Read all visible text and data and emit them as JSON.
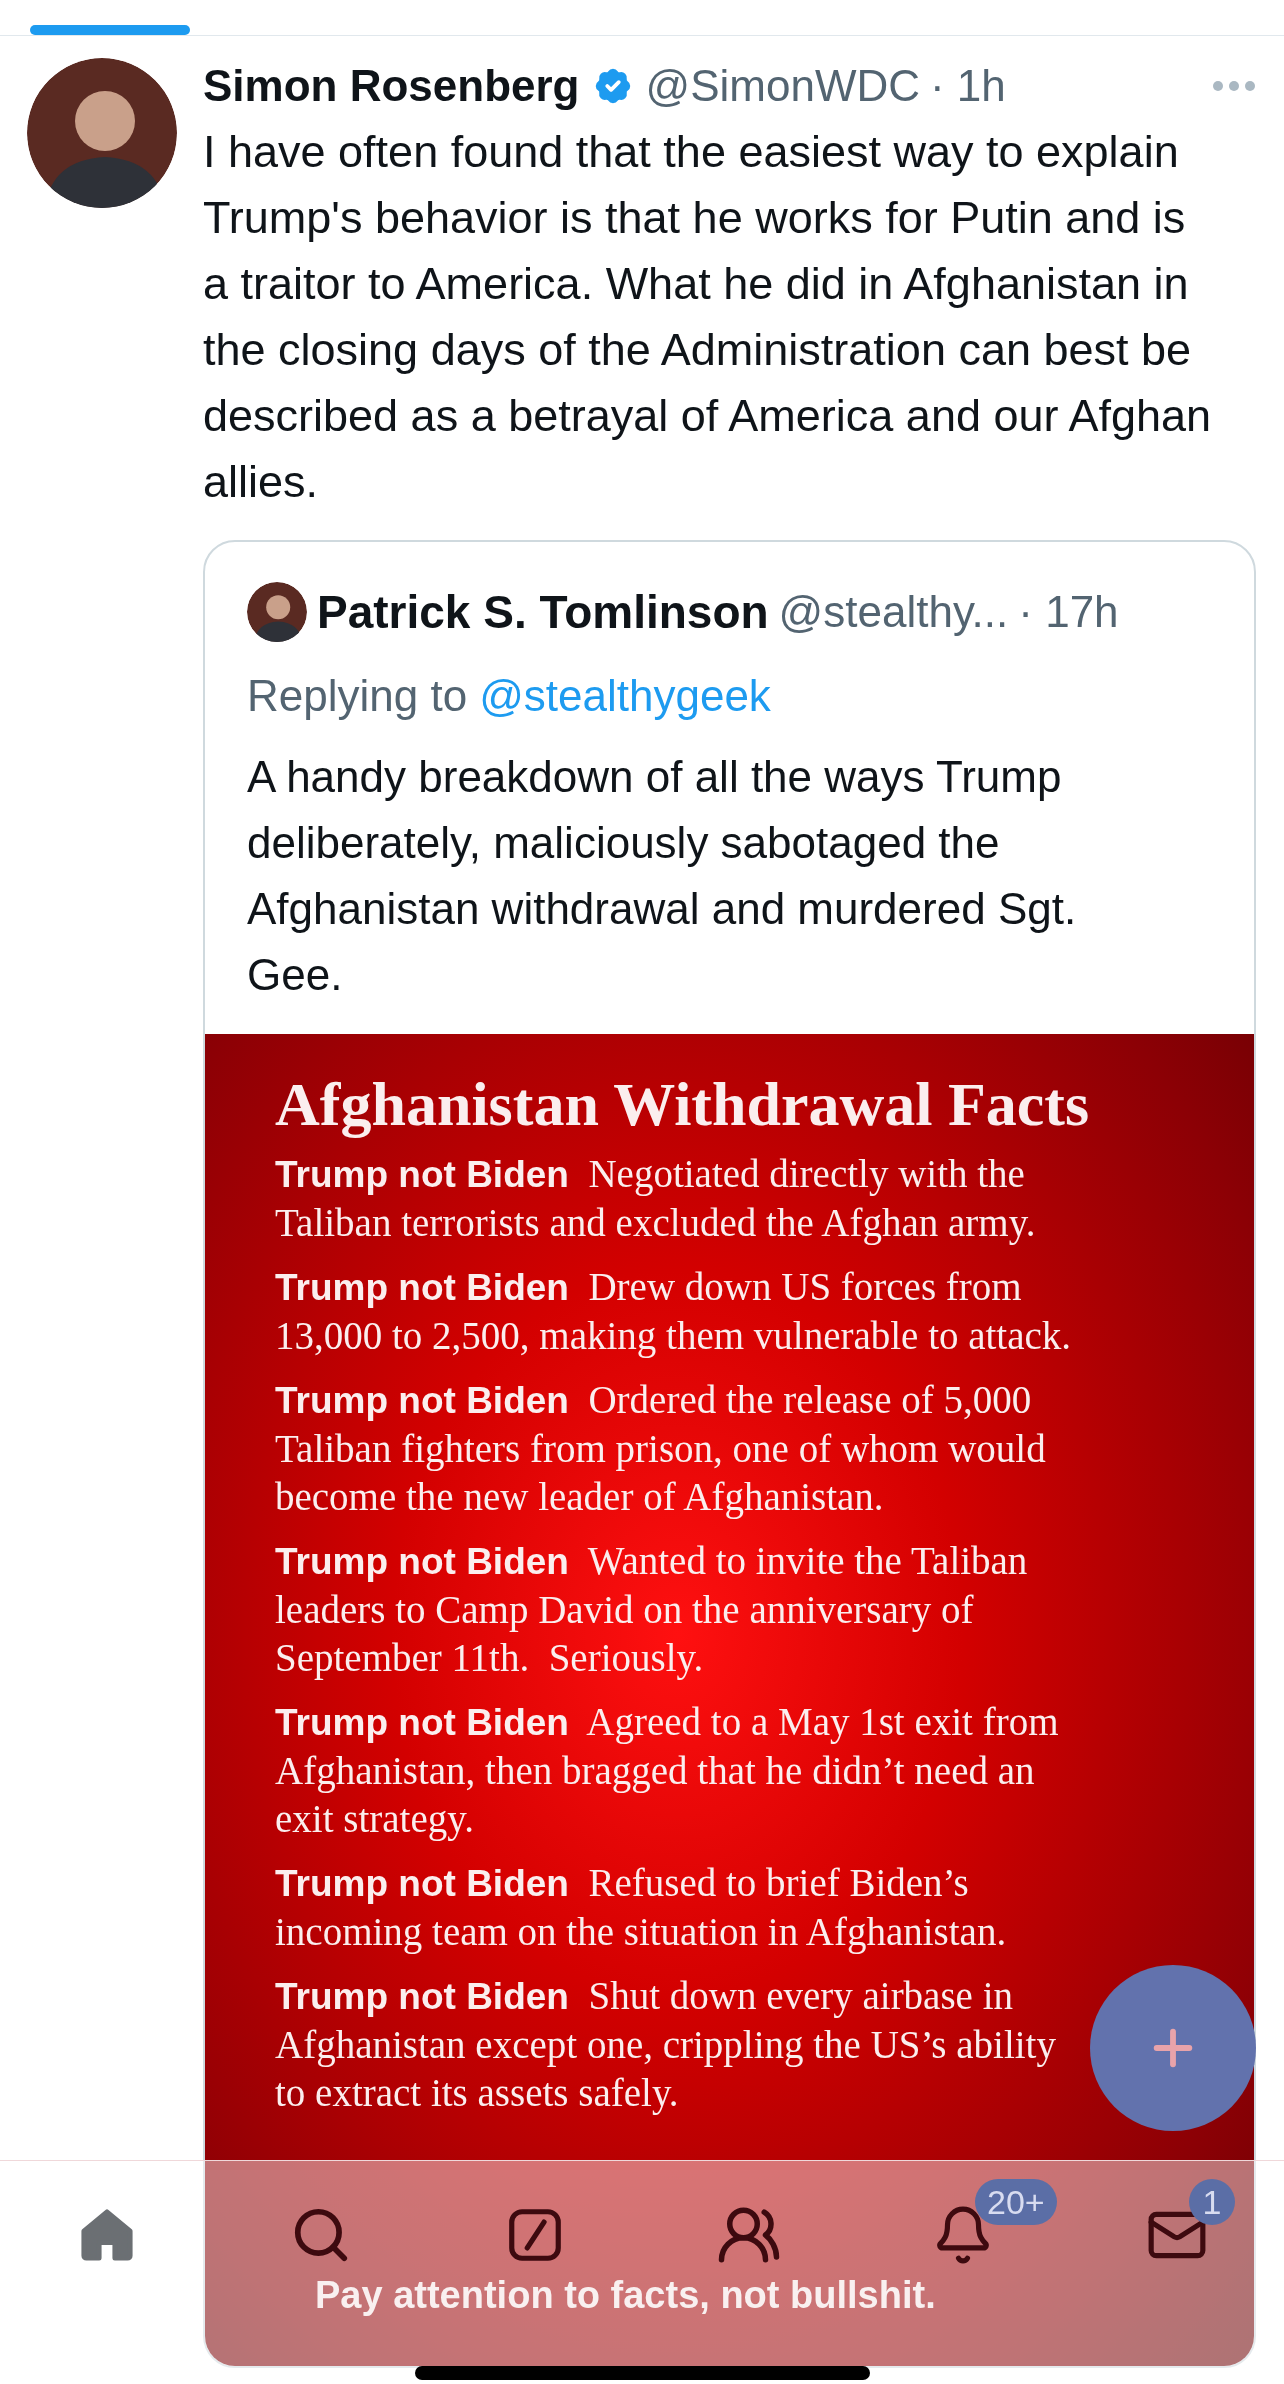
{
  "tweet": {
    "author": {
      "name": "Simon Rosenberg",
      "verified": true,
      "handle": "@SimonWDC",
      "time": "· 1h"
    },
    "text": "I have often found that the easiest way to explain Trump's behavior is that he works for Putin and is a traitor to America.  What he did in Afghanistan in the closing days of the Administration can best be described as a betrayal of America and our Afghan allies.",
    "quote": {
      "author": {
        "name": "Patrick S. Tomlinson",
        "handle": "@stealthy...",
        "time": "· 17h"
      },
      "replying_to": {
        "label": "Replying to",
        "handle": "@stealthygeek"
      },
      "text": "A handy breakdown of all the ways Trump deliberately, maliciously sabotaged the Afghanistan withdrawal and murdered Sgt. Gee.",
      "image": {
        "title": "Afghanistan Withdrawal Facts",
        "facts": [
          {
            "text": "**Trump not Biden**  Negotiated directly with the Taliban terrorists and excluded the Afghan army."
          },
          {
            "text": "**Trump not Biden**  Drew down US forces from 13,000 to 2,500, making them vulnerable to attack."
          },
          {
            "text": "**Trump not Biden**  Ordered the release of 5,000 Taliban fighters from prison, one of whom would become the new leader of Afghanistan."
          },
          {
            "text": "**Trump not Biden**  Wanted to invite the Taliban leaders to Camp David on the anniversary of September 11th.  Seriously."
          },
          {
            "text": "**Trump not Biden**  Agreed to a May 1st exit from Afghanistan, then bragged that he didn’t need an exit strategy."
          },
          {
            "text": "**Trump not Biden**  Refused to brief Biden’s incoming team on the situation in Afghanistan."
          },
          {
            "text": "**Trump not Biden**  Shut down every airbase in Afghanistan except one, crippling the US’s ability to extract its assets safely."
          }
        ],
        "footer": "Pay attention to facts, not bullshit."
      }
    }
  },
  "nav": {
    "items": [
      {
        "kind": "home",
        "selected": true
      },
      {
        "kind": "search",
        "selected": false
      },
      {
        "kind": "compose",
        "selected": false
      },
      {
        "kind": "communities",
        "selected": false
      },
      {
        "kind": "notifications",
        "selected": false,
        "badge": "20+"
      },
      {
        "kind": "messages",
        "selected": false,
        "badge": "1"
      }
    ]
  }
}
